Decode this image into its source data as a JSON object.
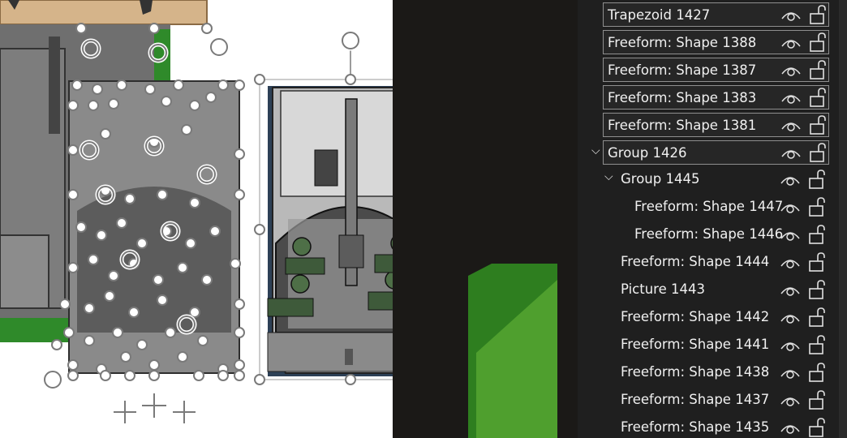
{
  "selection_pane": {
    "items": [
      {
        "label": "Trapezoid 1427",
        "selected": true
      },
      {
        "label": "Freeform: Shape 1388",
        "selected": true
      },
      {
        "label": "Freeform: Shape 1387",
        "selected": true
      },
      {
        "label": "Freeform: Shape 1383",
        "selected": true
      },
      {
        "label": "Freeform: Shape 1381",
        "selected": true
      },
      {
        "label": "Group 1426",
        "selected": true,
        "expanded": true
      },
      {
        "label": "Group 1445",
        "selected": false,
        "expanded": true
      },
      {
        "label": "Freeform: Shape 1447",
        "selected": false
      },
      {
        "label": "Freeform: Shape 1446",
        "selected": false
      },
      {
        "label": "Freeform: Shape 1444",
        "selected": false
      },
      {
        "label": "Picture 1443",
        "selected": false
      },
      {
        "label": "Freeform: Shape 1442",
        "selected": false
      },
      {
        "label": "Freeform: Shape 1441",
        "selected": false
      },
      {
        "label": "Freeform: Shape 1438",
        "selected": false
      },
      {
        "label": "Freeform: Shape 1437",
        "selected": false
      },
      {
        "label": "Freeform: Shape 1435",
        "selected": false
      }
    ],
    "icons": {
      "visibility": "eye-icon",
      "lock": "unlock-icon",
      "expand": "chevron-down-icon"
    }
  },
  "canvas": {
    "colors": {
      "background": "#ffffff",
      "dark": "#1b1917",
      "green": "#3f8f2a",
      "tan": "#d5b48a",
      "handle": "#ffffff",
      "handle_stroke": "#7a7a7a"
    }
  }
}
